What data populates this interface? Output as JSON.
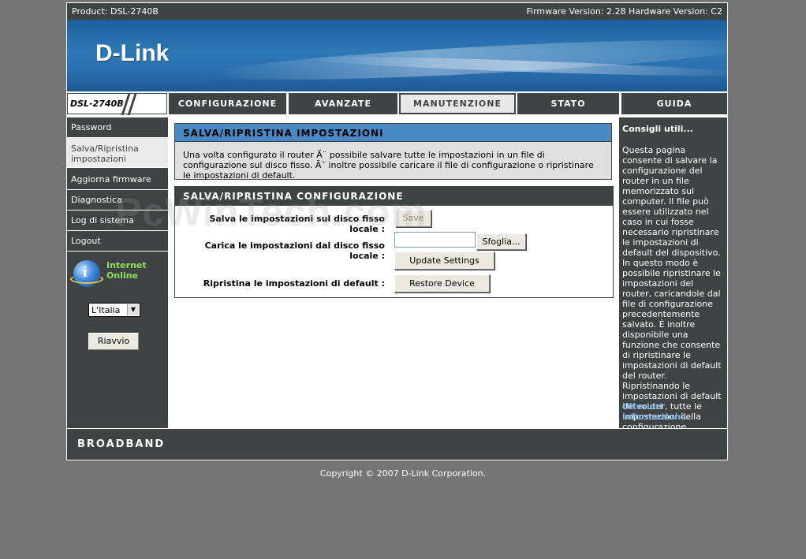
{
  "topbar": {
    "product": "Product: DSL-2740B",
    "versions": "Firmware Version: 2.28 Hardware Version: C2"
  },
  "banner": {
    "logo": "D-Link"
  },
  "model_badge": "DSL-2740B",
  "tabs": [
    {
      "label": "CONFIGURAZIONE",
      "active": false
    },
    {
      "label": "AVANZATE",
      "active": false
    },
    {
      "label": "MANUTENZIONE",
      "active": true
    },
    {
      "label": "STATO",
      "active": false
    },
    {
      "label": "GUIDA",
      "active": false
    }
  ],
  "sidebar": {
    "items": [
      {
        "label": "Password"
      },
      {
        "label": "Salva/Ripristina impostazioni"
      },
      {
        "label": "Aggiorna firmware"
      },
      {
        "label": "Diagnostica"
      },
      {
        "label": "Log di sistema"
      },
      {
        "label": "Logout"
      }
    ],
    "internet_status_line1": "Internet",
    "internet_status_line2": "Online",
    "language": "L'Italia",
    "reboot_label": "Riavvio"
  },
  "section1": {
    "title": "SALVA/RIPRISTINA IMPOSTAZIONI",
    "body": "Una volta configurato il router Ã¨ possibile salvare tutte le impostazioni in un file di configurazione sul disco fisso. Ãˆ inoltre possibile caricare il file di configurazione o ripristinare le impostazioni di default."
  },
  "section2": {
    "title": "SALVA/RIPRISTINA CONFIGURAZIONE",
    "save_label": "Salva le impostazioni sul disco fisso locale :",
    "save_button": "Save",
    "load_label_line1": "Carica le impostazioni dal disco fisso",
    "load_label_line2": "locale :",
    "browse_button": "Sfoglia...",
    "update_button": "Update Settings",
    "restore_label": "Ripristina le impostazioni di default :",
    "restore_button": "Restore Device"
  },
  "watermark": "PcWinTech.com",
  "help": {
    "title": "Consigli utili...",
    "text": "Questa pagina consente di salvare la configurazione del router in un file memorizzato sul computer. Il file può essere utilizzato nel caso in cui fosse necessario ripristinare le impostazioni di default del dispositivo. In questo modo è possibile ripristinare le impostazioni del router, caricandole dal file di configurazione precedentemente salvato. È inoltre disponibile una funzione che consente di ripristinare le impostazioni di default del router. Ripristinando le impostazioni di default del router, tutte le impostazioni della configurazione corrente vengono cancellate.",
    "more_link": "Ulteriori informazioni..."
  },
  "footer": {
    "brand": "BROADBAND"
  },
  "copyright": "Copyright © 2007 D-Link Corporation.",
  "colors": {
    "page_bg": "#757575",
    "dark_panel": "#404343",
    "section_accent": "#4a8ac4",
    "status_green": "#8ee05c",
    "link_blue": "#7fb6f0"
  }
}
